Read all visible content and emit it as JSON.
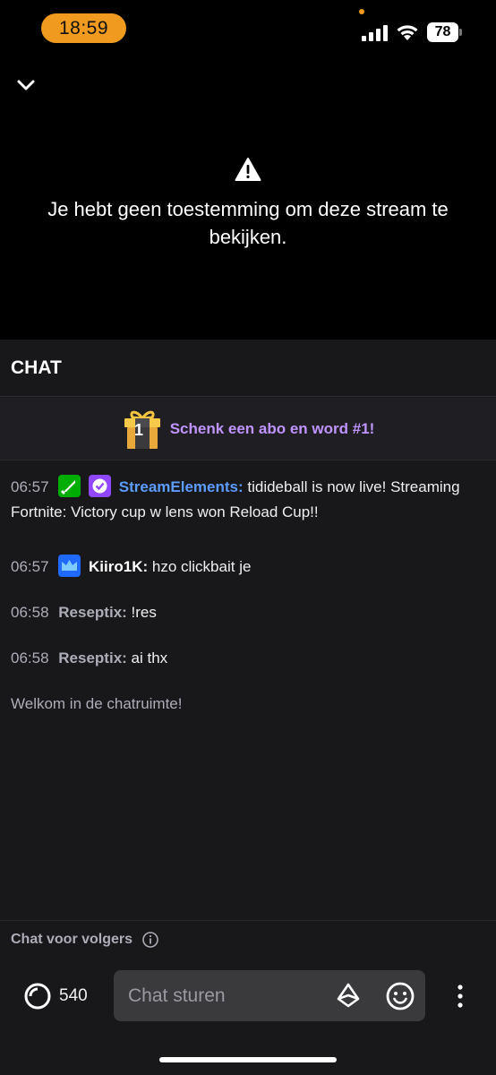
{
  "status_bar": {
    "time": "18:59",
    "battery_level": "78"
  },
  "video": {
    "message": "Je hebt geen toestemming om deze stream te bekijken.",
    "warning_icon": "warning-triangle-icon",
    "collapse_icon": "chevron-down-icon"
  },
  "chat": {
    "header": "CHAT",
    "gift_banner": {
      "text": "Schenk een abo en word #1!",
      "badge_number": "1"
    },
    "messages": [
      {
        "time": "06:57",
        "user": "StreamElements:",
        "user_color": "#5c9cff",
        "text": "tidideball is now live! Streaming Fortnite: Victory cup w lens won Reload Cup!!"
      },
      {
        "time": "06:57",
        "user": "Kiiro1K:",
        "user_color": "#ffffff",
        "text": "hzo clickbait je"
      },
      {
        "time": "06:58",
        "user": "Reseptix:",
        "user_color": "#adadb8",
        "text": "!res"
      },
      {
        "time": "06:58",
        "user": "Reseptix:",
        "user_color": "#adadb8",
        "text": "ai thx"
      }
    ],
    "welcome": "Welkom in de chatruimte!",
    "followers_mode": "Chat voor volgers"
  },
  "bottom": {
    "points": "540",
    "input_placeholder": "Chat sturen"
  },
  "colors": {
    "accent_purple": "#bf94ff",
    "status_orange": "#f09a1f",
    "badge_green": "#00ad03",
    "badge_purple": "#9146ff",
    "badge_blue": "#1f69ff"
  }
}
